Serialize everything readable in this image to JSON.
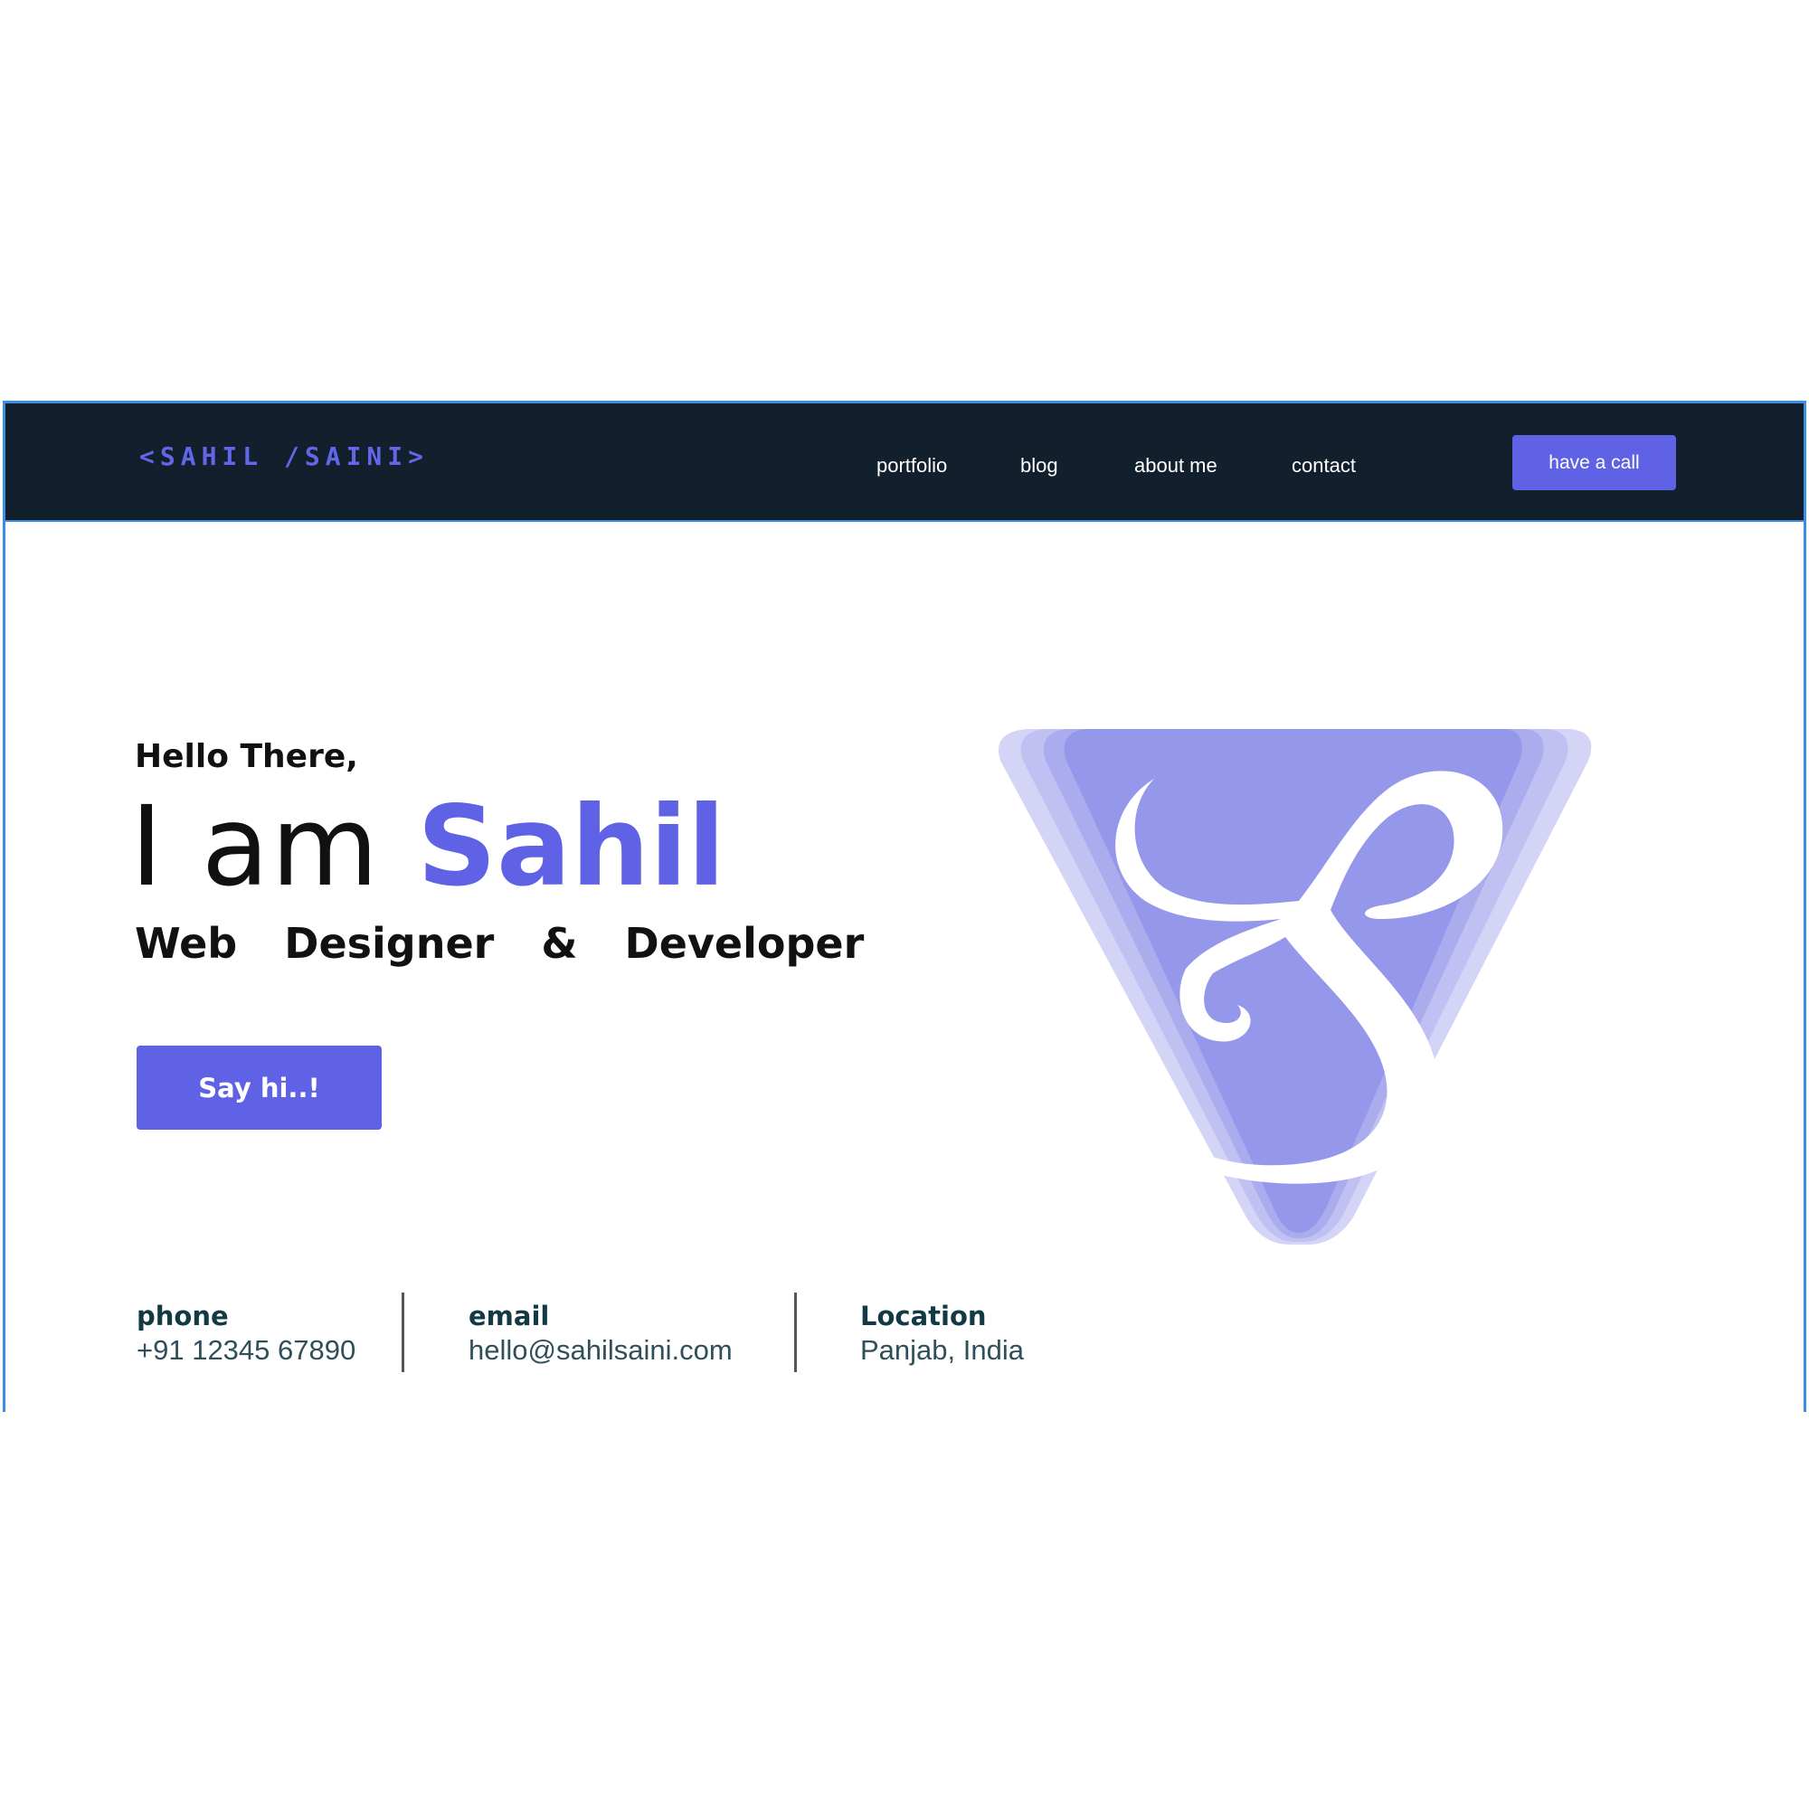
{
  "nav": {
    "logo": "<SAHIL /SAINI>",
    "links": [
      "portfolio",
      "blog",
      "about me",
      "contact"
    ],
    "cta": "have a call"
  },
  "hero": {
    "greeting": "Hello There,",
    "headline_prefix": "I am ",
    "headline_name": "Sahil",
    "role": "Web  Designer  &  Developer",
    "button": "Say hi..!"
  },
  "contact": {
    "phone_label": "phone",
    "phone_value": "+91 12345 67890",
    "email_label": "email",
    "email_value": "hello@sahilsaini.com",
    "location_label": "Location",
    "location_value": "Panjab, India"
  },
  "colors": {
    "accent": "#5f62e4",
    "navbar": "#121f2c",
    "emblem_main": "#9597eb",
    "emblem_light": "#d3d4f6",
    "frame_border": "#3a8ee6"
  }
}
